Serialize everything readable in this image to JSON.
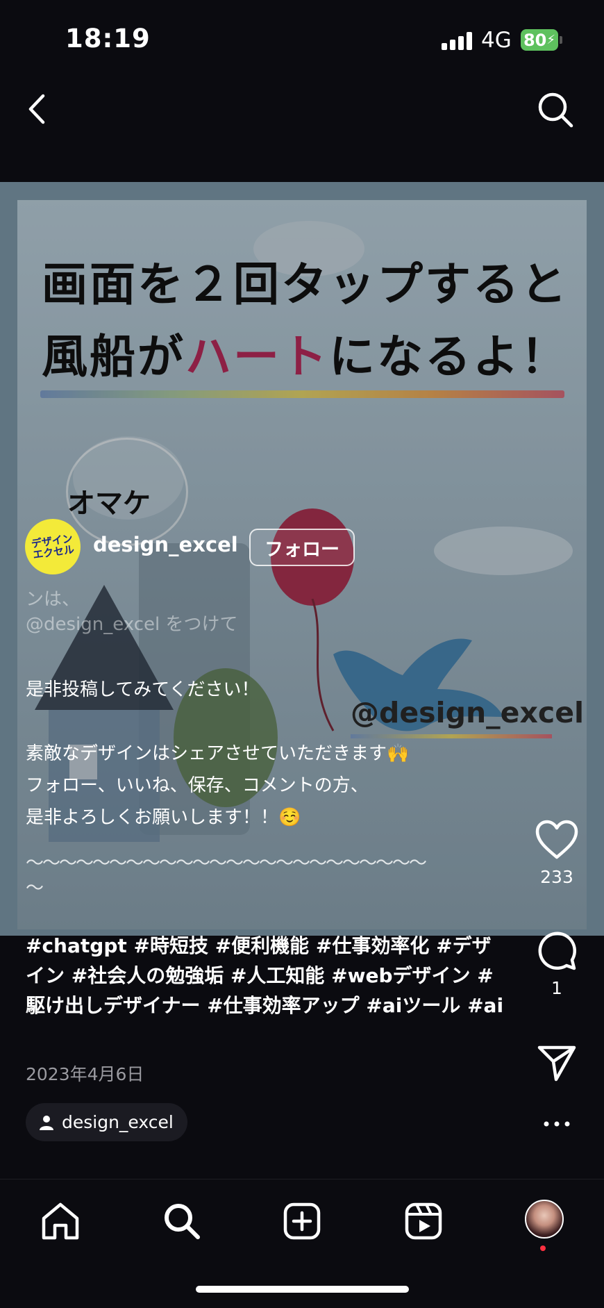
{
  "status_bar": {
    "time": "18:19",
    "network": "4G",
    "battery": "80"
  },
  "media": {
    "title_line1": "画面を２回タップすると",
    "title_line2_pre": "風船が",
    "title_line2_accent": "ハート",
    "title_line2_post": "になるよ！",
    "side_text": "オマケ",
    "watermark": "@design_excel"
  },
  "author": {
    "avatar_text": "デザイン エクセル",
    "username": "design_excel",
    "follow_label": "フォロー"
  },
  "caption": {
    "faded_line1": "ンは、",
    "faded_line2": "@design_excel をつけて",
    "line1": "是非投稿してみてください！",
    "line2": "素敵なデザインはシェアさせていただきます🙌",
    "line3": "フォロー、いいね、保存、コメントの方、",
    "line4": "是非よろしくお願いします！！☺️",
    "wave1": "〜〜〜〜〜〜〜〜〜〜〜〜〜〜〜〜〜〜〜〜〜〜〜〜",
    "wave2": "〜"
  },
  "hashtags": "#chatgpt #時短技 #便利機能 #仕事効率化 #デザイン #社会人の勉強垢 #人工知能 #webデザイン #駆け出しデザイナー #仕事効率アップ #aiツール #ai",
  "post_date": "2023年4月6日",
  "tagged_user": "design_excel",
  "actions": {
    "likes": "233",
    "comments": "1"
  },
  "colors": {
    "accent": "#b52a59",
    "follow_border": "#ffffff",
    "battery": "#5ec15e"
  }
}
